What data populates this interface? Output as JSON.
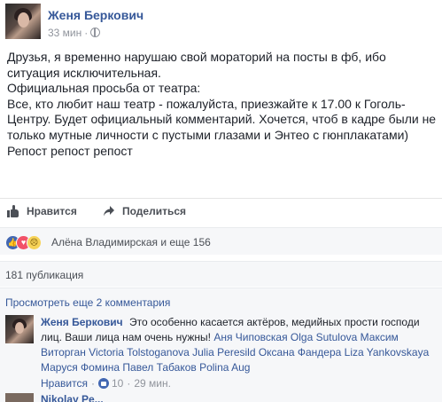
{
  "post": {
    "author": "Женя Беркович",
    "time": "33 мин",
    "dot": "·",
    "privacy_icon": "globe-icon",
    "body": [
      "Друзья, я временно нарушаю свой мораторий на посты в фб, ибо ситуация исключительная.",
      "Официальная просьба от театра:",
      "Все, кто любит наш театр - пожалуйста, приезжайте к 17.00 к Гоголь-Центру. Будет официальный комментарий. Хочется, чтоб в кадре были не только мутные личности с пустыми глазами и Энтео с г​юнплакатами)",
      "Репост репост репост"
    ]
  },
  "actions": {
    "like_label": "Нравится",
    "share_label": "Поделиться"
  },
  "reactions": {
    "names": "Алёна Владимирская и еще 156",
    "colors": {
      "like": "#4267b2",
      "love": "#f25268",
      "sad": "#f7d358"
    }
  },
  "shares": {
    "count_label": "181 публикация"
  },
  "comments": {
    "more_label": "Просмотреть еще 2 комментария",
    "first": {
      "author": "Женя Беркович",
      "text": "Это особенно касается актёров, медийных прости господи лиц. Ваши лица нам очень нужны!",
      "mentions": "Аня Чиповская Olga Sutulova Максим Виторган Victoria Tolstoganova Julia Peresild Оксана Фандера Liza Yankovskaya Маруся Фомина Павел Табаков Polina Aug",
      "like_label": "Нравится",
      "likes": "10",
      "time": "29 мин."
    },
    "next": {
      "author": "Nikolay Pe..."
    }
  },
  "colors": {
    "link": "#365899",
    "text": "#1d2129",
    "muted": "#90949c",
    "bar_bg": "#f6f7f9"
  }
}
